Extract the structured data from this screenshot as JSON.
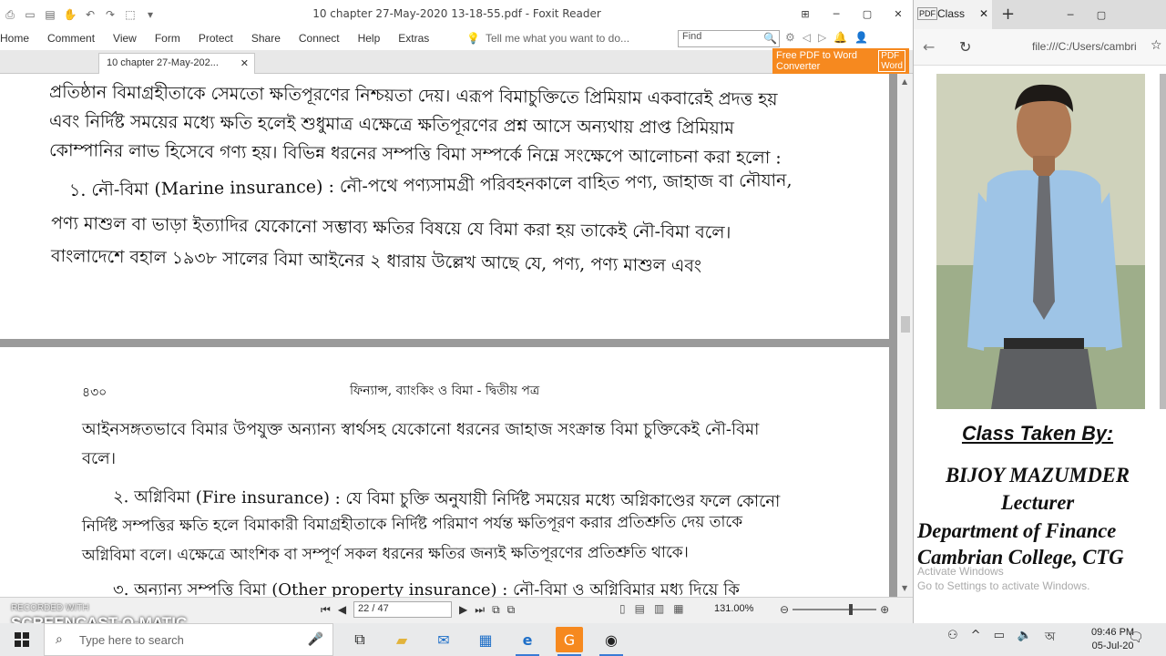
{
  "foxit": {
    "window_title": "10 chapter 27-May-2020 13-18-55.pdf - Foxit Reader",
    "menu": [
      "Home",
      "Comment",
      "View",
      "Form",
      "Protect",
      "Share",
      "Connect",
      "Help",
      "Extras"
    ],
    "tell_me": "Tell me what you want to do...",
    "find_placeholder": "Find",
    "tab_label": "10 chapter 27-May-202...",
    "promo": {
      "line1": "Free PDF to Word",
      "line2": "Converter",
      "badge_top": "PDF",
      "badge_bottom": "Word"
    },
    "page1_lines": [
      "প্রতিষ্ঠান বিমাগ্রহীতাকে সেমতো ক্ষতিপূরণের নিশ্চয়তা দেয়। এরূপ বিমাচুক্তিতে প্রিমিয়াম একবারেই প্রদত্ত হয়",
      "এবং নির্দিষ্ট সময়ের মধ্যে ক্ষতি হলেই শুধুমাত্র এক্ষেত্রে ক্ষতিপূরণের প্রশ্ন আসে অন্যথায় প্রাপ্ত প্রিমিয়াম",
      "কোম্পানির লাভ হিসেবে গণ্য হয়। বিভিন্ন ধরনের সম্পত্তি বিমা সম্পর্কে নিম্নে সংক্ষেপে আলোচনা করা হলো :",
      "১. নৌ-বিমা (Marine insurance) : নৌ-পথে পণ্যসামগ্রী পরিবহনকালে বাহিত পণ্য, জাহাজ বা নৌযান,",
      "পণ্য মাশুল বা ভাড়া ইত্যাদির যেকোনো সম্ভাব্য ক্ষতির বিষয়ে যে বিমা করা হয় তাকেই নৌ-বিমা বলে।",
      "বাংলাদেশে বহাল ১৯৩৮ সালের বিমা আইনের ২ ধারায় উল্লেখ আছে যে, পণ্য, পণ্য মাশুল এবং"
    ],
    "page2_number": "৪৩০",
    "page2_header": "ফিন্যান্স, ব্যাংকিং ও বিমা - দ্বিতীয় পত্র",
    "page2_lines": [
      "আইনসঙ্গতভাবে বিমার উপযুক্ত অন্যান্য স্বার্থসহ যেকোনো ধরনের জাহাজ সংক্রান্ত বিমা চুক্তিকেই নৌ-বিমা",
      "বলে।",
      "২. অগ্নিবিমা (Fire insurance) : যে বিমা চুক্তি অনুযায়ী নির্দিষ্ট সময়ের মধ্যে অগ্নিকাণ্ডের ফলে কোনো",
      "নির্দিষ্ট সম্পত্তির ক্ষতি হলে বিমাকারী বিমাগ্রহীতাকে নির্দিষ্ট পরিমাণ পর্যন্ত ক্ষতিপূরণ করার প্রতিশ্রুতি দেয় তাকে",
      "অগ্নিবিমা বলে। এক্ষেত্রে আংশিক বা সম্পূর্ণ সকল ধরনের ক্ষতির জন্যই ক্ষতিপূরণের প্রতিশ্রুতি থাকে।",
      "৩. অন্যান্য সম্পত্তি বিমা (Other property insurance) : নৌ-বিমা ও অগ্নিবিমার মধ্য দিয়ে কি"
    ],
    "page_indicator": "22 / 47",
    "zoom": "131.00%",
    "zoom_fraction": 0.7
  },
  "watermark": {
    "small": "RECORDED WITH",
    "large": "SCREENCAST-O-MATIC"
  },
  "browser": {
    "tab_label": "Class",
    "url": "file:///C:/Users/cambri",
    "caption_title": "Class Taken By:",
    "caption_name": "BIJOY MAZUMDER",
    "caption_role": "Lecturer",
    "caption_dept": "Department of Finance",
    "caption_college": "Cambrian College, CTG",
    "activate_line1": "Activate Windows",
    "activate_line2": "Go to Settings to activate Windows."
  },
  "taskbar": {
    "search_placeholder": "Type here to search",
    "time": "09:46 PM",
    "date": "05-Jul-20"
  },
  "colors": {
    "promo_orange": "#f6891f",
    "taskbar": "#e9eaeb",
    "doc_gray": "#9a9a9a"
  }
}
